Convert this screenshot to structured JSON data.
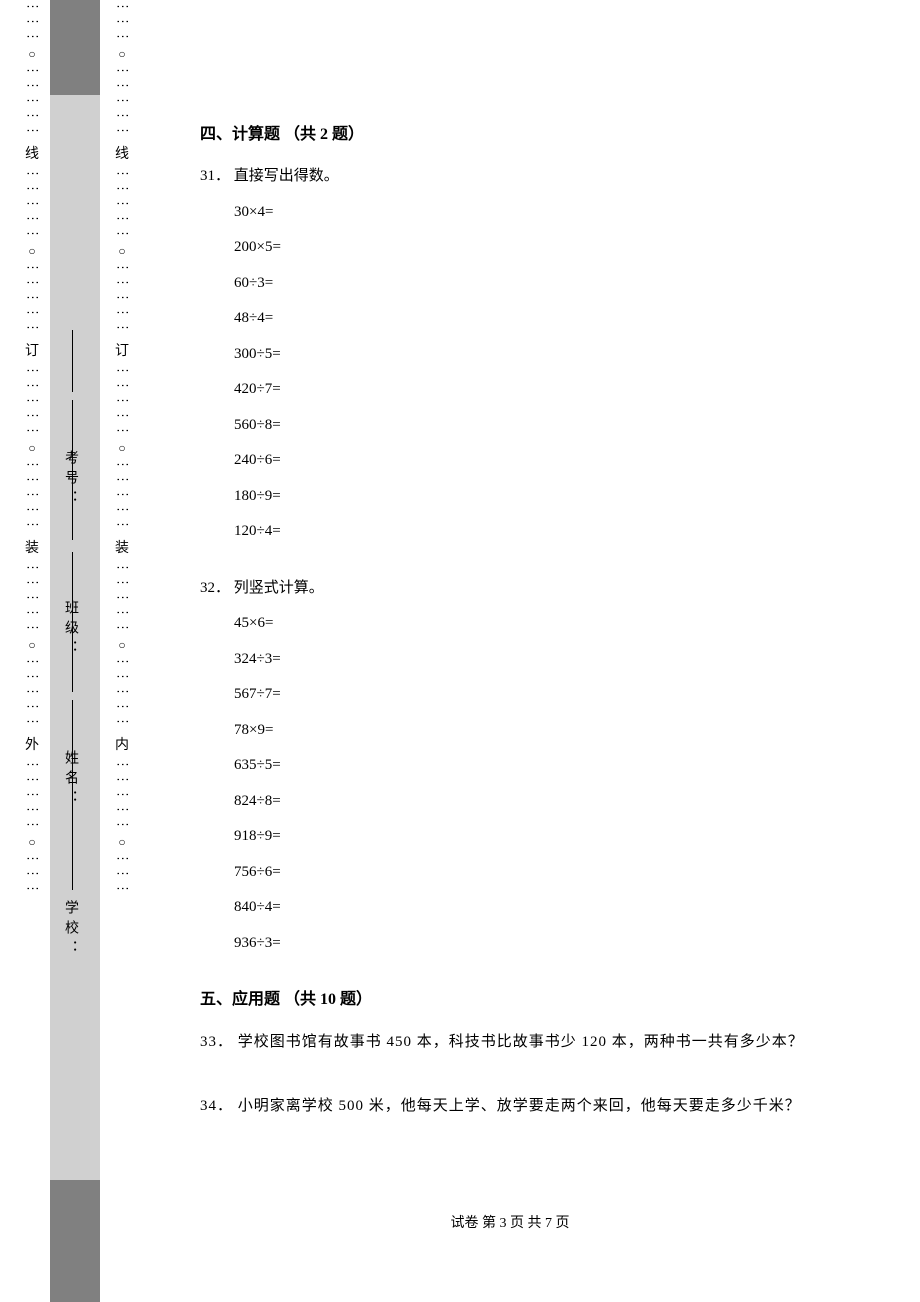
{
  "binding": {
    "outer_chars": [
      "外"
    ],
    "inner_chars": [
      "内"
    ],
    "markers": [
      "装",
      "订",
      "线"
    ],
    "labels": {
      "school": "学校：",
      "name": "姓名：",
      "class": "班级：",
      "exam_no": "考号："
    }
  },
  "sections": {
    "s4": {
      "title": "四、计算题 （共 2 题）",
      "q31": {
        "num": "31．",
        "text": "直接写出得数。",
        "items": [
          "30×4=",
          "200×5=",
          "60÷3=",
          "48÷4=",
          "300÷5=",
          "420÷7=",
          "560÷8=",
          "240÷6=",
          "180÷9=",
          "120÷4="
        ]
      },
      "q32": {
        "num": "32．",
        "text": "列竖式计算。",
        "items": [
          "45×6=",
          "324÷3=",
          "567÷7=",
          "78×9=",
          "635÷5=",
          "824÷8=",
          "918÷9=",
          "756÷6=",
          "840÷4=",
          "936÷3="
        ]
      }
    },
    "s5": {
      "title": "五、应用题 （共 10 题）",
      "q33": {
        "num": "33．",
        "text": "学校图书馆有故事书 450 本，科技书比故事书少 120 本，两种书一共有多少本？"
      },
      "q34": {
        "num": "34．",
        "text": "小明家离学校 500 米，他每天上学、放学要走两个来回，他每天要走多少千米？"
      }
    }
  },
  "footer": "试卷  第 3 页  共 7 页"
}
